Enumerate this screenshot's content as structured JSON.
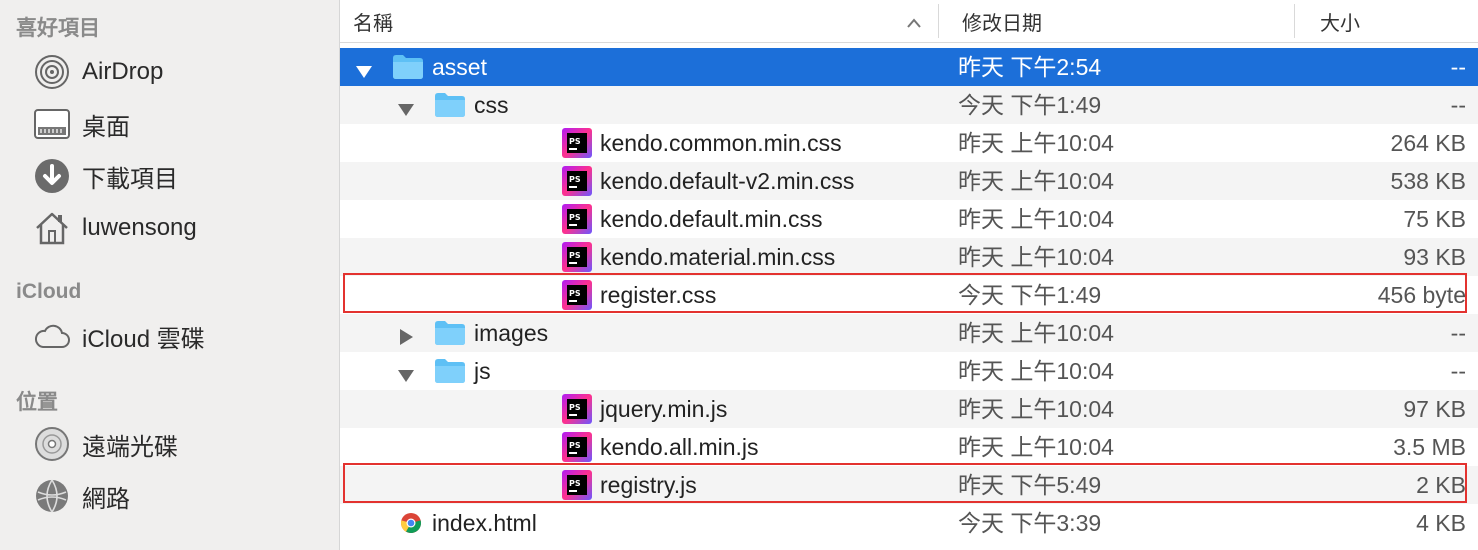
{
  "sidebar": {
    "favorites_title": "喜好項目",
    "favorites": [
      {
        "label": "AirDrop",
        "icon": "airdrop-icon"
      },
      {
        "label": "桌面",
        "icon": "desktop-icon"
      },
      {
        "label": "下載項目",
        "icon": "downloads-icon"
      },
      {
        "label": "luwensong",
        "icon": "home-icon"
      }
    ],
    "icloud_title": "iCloud",
    "icloud": [
      {
        "label": "iCloud 雲碟",
        "icon": "cloud-icon"
      }
    ],
    "locations_title": "位置",
    "locations": [
      {
        "label": "遠端光碟",
        "icon": "remote-disc-icon"
      },
      {
        "label": "網路",
        "icon": "network-icon"
      }
    ]
  },
  "columns": {
    "name": "名稱",
    "date": "修改日期",
    "size": "大小"
  },
  "rows": [
    {
      "name": "asset",
      "date": "昨天 下午2:54",
      "size": "--",
      "kind": "folder",
      "expanded": true,
      "selected": true
    },
    {
      "name": "css",
      "date": "今天 下午1:49",
      "size": "--",
      "kind": "folder",
      "expanded": true
    },
    {
      "name": "kendo.common.min.css",
      "date": "昨天 上午10:04",
      "size": "264 KB",
      "kind": "ps-file"
    },
    {
      "name": "kendo.default-v2.min.css",
      "date": "昨天 上午10:04",
      "size": "538 KB",
      "kind": "ps-file"
    },
    {
      "name": "kendo.default.min.css",
      "date": "昨天 上午10:04",
      "size": "75 KB",
      "kind": "ps-file"
    },
    {
      "name": "kendo.material.min.css",
      "date": "昨天 上午10:04",
      "size": "93 KB",
      "kind": "ps-file"
    },
    {
      "name": "register.css",
      "date": "今天 下午1:49",
      "size": "456 byte",
      "kind": "ps-file",
      "highlighted": true
    },
    {
      "name": "images",
      "date": "昨天 上午10:04",
      "size": "--",
      "kind": "folder",
      "expanded": false
    },
    {
      "name": "js",
      "date": "昨天 上午10:04",
      "size": "--",
      "kind": "folder",
      "expanded": true
    },
    {
      "name": "jquery.min.js",
      "date": "昨天 上午10:04",
      "size": "97 KB",
      "kind": "ps-file"
    },
    {
      "name": "kendo.all.min.js",
      "date": "昨天 上午10:04",
      "size": "3.5 MB",
      "kind": "ps-file"
    },
    {
      "name": "registry.js",
      "date": "昨天 下午5:49",
      "size": "2 KB",
      "kind": "ps-file",
      "highlighted": true
    },
    {
      "name": "index.html",
      "date": "今天 下午3:39",
      "size": "4 KB",
      "kind": "chrome-file"
    }
  ],
  "colors": {
    "selection": "#1c6fd9",
    "highlight_border": "#e3322f",
    "folder": "#5ec0f5"
  }
}
